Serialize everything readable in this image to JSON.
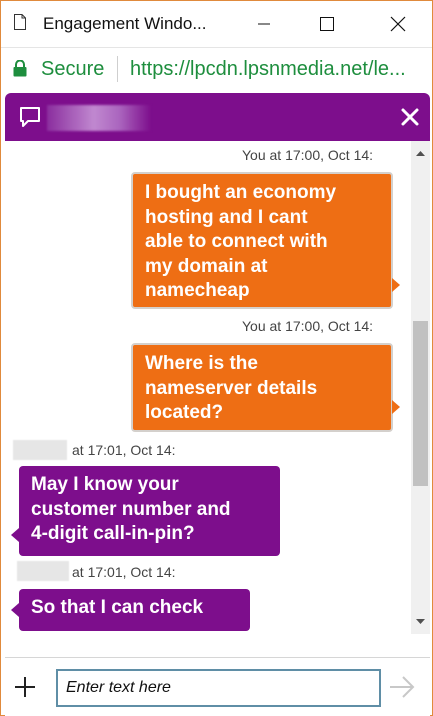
{
  "window": {
    "title": "Engagement Windo...",
    "controls": [
      "minimize-icon",
      "maximize-icon",
      "close-icon"
    ]
  },
  "address_bar": {
    "secure_label": "Secure",
    "url": "https://lpcdn.lpsnmedia.net/le..."
  },
  "chat_header": {
    "icon": "chat-bubble-icon",
    "close_icon": "close-icon"
  },
  "messages": [
    {
      "from": "visitor",
      "meta": "You at 17:00, Oct 14:",
      "text_lines": [
        "I bought an economy",
        "hosting and I cant",
        "able to connect with",
        "my domain at",
        "namecheap"
      ]
    },
    {
      "from": "visitor",
      "meta": "You at 17:00, Oct 14:",
      "text_lines": [
        "Where is the",
        "nameserver details",
        "located?"
      ]
    },
    {
      "from": "agent",
      "meta": "at 17:01, Oct 14:",
      "text_lines": [
        "May I know your",
        "customer number and",
        "4-digit call-in-pin?"
      ]
    },
    {
      "from": "agent",
      "meta": "at 17:01, Oct 14:",
      "text_lines": [
        "So that I can check"
      ]
    }
  ],
  "composer": {
    "add_icon": "plus-icon",
    "placeholder": "Enter text here",
    "send_icon": "send-arrow-icon"
  },
  "colors": {
    "brand_purple": "#7d0e8c",
    "visitor_orange": "#ee6e14",
    "secure_green": "#1e8e3e",
    "window_border": "#e08a3c"
  }
}
